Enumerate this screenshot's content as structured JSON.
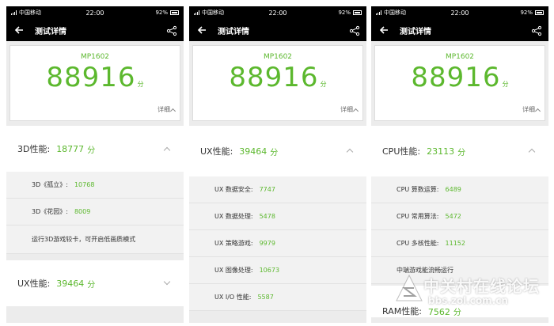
{
  "status": {
    "carrier": "中国移动",
    "time": "22:00",
    "battery": "92%"
  },
  "title": "测试详情",
  "model": "MP1602",
  "score": "88916",
  "score_unit": "分",
  "detail_label": "详细",
  "screens": [
    {
      "section1": {
        "label": "3D性能:",
        "value": "18777",
        "unit": "分",
        "items": [
          {
            "label": "3D《孤立》:",
            "value": "10768"
          },
          {
            "label": "3D《花园》:",
            "value": "8009"
          },
          {
            "label": "运行3D游戏较卡，可开启低画质模式",
            "value": ""
          }
        ]
      },
      "section2": {
        "label": "UX性能:",
        "value": "39464",
        "unit": "分"
      }
    },
    {
      "section1": {
        "label": "UX性能:",
        "value": "39464",
        "unit": "分",
        "items": [
          {
            "label": "UX 数据安全:",
            "value": "7747"
          },
          {
            "label": "UX 数据处理:",
            "value": "5478"
          },
          {
            "label": "UX 策略游戏:",
            "value": "9979"
          },
          {
            "label": "UX 图像处理:",
            "value": "10673"
          },
          {
            "label": "UX I/O 性能:",
            "value": "5587"
          }
        ]
      }
    },
    {
      "section1": {
        "label": "CPU性能:",
        "value": "23113",
        "unit": "分",
        "items": [
          {
            "label": "CPU 算数运算:",
            "value": "6489"
          },
          {
            "label": "CPU 常用算法:",
            "value": "5472"
          },
          {
            "label": "CPU 多核性能:",
            "value": "11152"
          },
          {
            "label": "中端游戏能流畅运行",
            "value": ""
          }
        ]
      },
      "section2": {
        "label": "RAM性能:",
        "value": "7562",
        "unit": "分"
      }
    }
  ],
  "watermark": {
    "line1": "中关村在线论坛",
    "line2": "bbs.zol.com.cn"
  },
  "colors": {
    "accent": "#5cb82e",
    "bar": "#000000"
  }
}
